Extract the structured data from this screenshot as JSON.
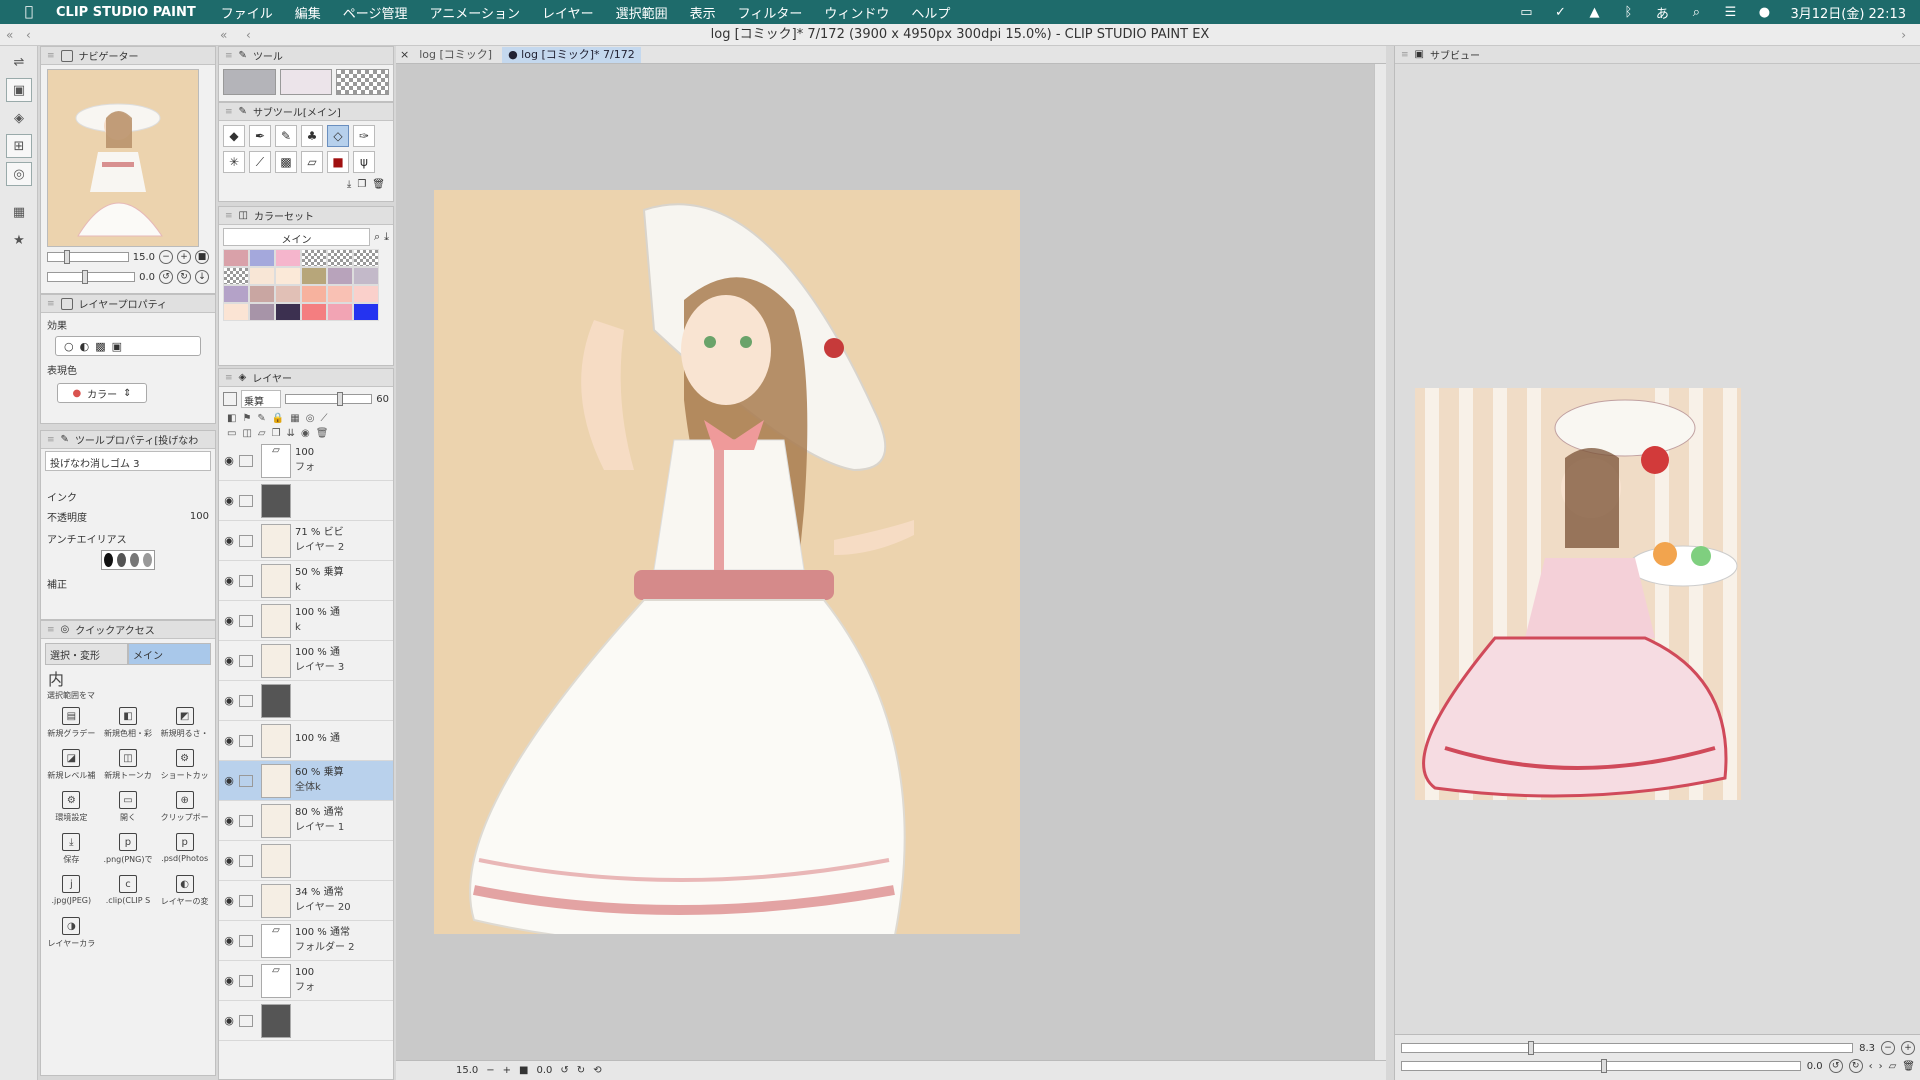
{
  "menubar": {
    "app_name": "CLIP STUDIO PAINT",
    "items": [
      "ファイル",
      "編集",
      "ページ管理",
      "アニメーション",
      "レイヤー",
      "選択範囲",
      "表示",
      "フィルター",
      "ウィンドウ",
      "ヘルプ"
    ],
    "clock": "3月12日(金)  22:13",
    "input_method": "あ"
  },
  "window": {
    "title": "log [コミック]* 7/172 (3900 x 4950px 300dpi 15.0%)  - CLIP STUDIO PAINT EX"
  },
  "navigator": {
    "title": "ナビゲーター",
    "zoom": "15.0",
    "rotation": "0.0"
  },
  "layer_property": {
    "title": "レイヤープロパティ",
    "effect_label": "効果",
    "expression_label": "表現色",
    "expression_value": "カラー"
  },
  "tool_property": {
    "title": "ツールプロパティ[投げなわ",
    "tool_name": "投げなわ消しゴム 3",
    "ink_label": "インク",
    "opacity_label": "不透明度",
    "opacity_value": "100",
    "antialias_label": "アンチエイリアス",
    "correction_label": "補正"
  },
  "quick_access": {
    "title": "クイックアクセス",
    "tabs": [
      "選択・変形",
      "メイン"
    ],
    "first_item": "選択範囲をマ",
    "items": [
      {
        "label": "新規グラデー",
        "icon": "▤"
      },
      {
        "label": "新規色相・彩",
        "icon": "◧"
      },
      {
        "label": "新規明るさ・",
        "icon": "◩"
      },
      {
        "label": "新規レベル補",
        "icon": "◪"
      },
      {
        "label": "新規トーンカ",
        "icon": "◫"
      },
      {
        "label": "ショートカッ",
        "icon": "⚙"
      },
      {
        "label": "環境設定",
        "icon": "⚙"
      },
      {
        "label": "開く",
        "icon": "▭"
      },
      {
        "label": "クリップボー",
        "icon": "⊕"
      },
      {
        "label": "保存",
        "icon": "⤓"
      },
      {
        "label": ".png(PNG)で",
        "icon": "p"
      },
      {
        "label": ".psd(Photos",
        "icon": "p"
      },
      {
        "label": ".jpg(JPEG)",
        "icon": "j"
      },
      {
        "label": ".clip(CLIP S",
        "icon": "c"
      },
      {
        "label": "レイヤーの変",
        "icon": "◐"
      },
      {
        "label": "レイヤーカラ",
        "icon": "◑"
      }
    ]
  },
  "tool_panel": {
    "title": "ツール"
  },
  "subtool": {
    "title": "サブツール[メイン]"
  },
  "colorset": {
    "title": "カラーセット",
    "set_name": "メイン",
    "colors": [
      "#d9a1a9",
      "#a4a8dc",
      "#f5b5cc",
      "checker",
      "checker",
      "checker",
      "checker",
      "#f8e6d6",
      "#fbe9d8",
      "#b7a67a",
      "#b8a3bb",
      "#c3b9c9",
      "#b4a2c8",
      "#c9a6a2",
      "#e1c0b6",
      "#f7b29e",
      "#f9c1b4",
      "#fad0cb",
      "#fbe4d4",
      "#a794a8",
      "#3c3050",
      "#f47e80",
      "#f2a4b4",
      "#2433f0"
    ]
  },
  "layers": {
    "title": "レイヤー",
    "blend_mode": "乗算",
    "opacity": "60",
    "rows": [
      {
        "pct": "100",
        "name": "フォ",
        "folder": true
      },
      {
        "pct": "",
        "name": "",
        "mask": true
      },
      {
        "pct": "71 % ビビ",
        "name": "レイヤー 2"
      },
      {
        "pct": "50 % 乗算",
        "name": "k"
      },
      {
        "pct": "100 % 通",
        "name": "k"
      },
      {
        "pct": "100 % 通",
        "name": "レイヤー 3"
      },
      {
        "pct": "",
        "name": "",
        "mask": true
      },
      {
        "pct": "100 % 通",
        "name": ""
      },
      {
        "pct": "60 % 乗算",
        "name": "全体k",
        "selected": true
      },
      {
        "pct": "80 % 通常",
        "name": "レイヤー 1"
      },
      {
        "pct": "",
        "name": ""
      },
      {
        "pct": "34 % 通常",
        "name": "レイヤー 20"
      },
      {
        "pct": "100 % 通常",
        "name": "フォルダー 2",
        "folder": true
      },
      {
        "pct": "100",
        "name": "フォ",
        "folder": true
      },
      {
        "pct": "",
        "name": "",
        "mask": true
      }
    ]
  },
  "canvas": {
    "tabs": [
      "log [コミック]",
      "● log [コミック]* 7/172"
    ],
    "zoom": "15.0",
    "rotation": "0.0"
  },
  "subview": {
    "title": "サブビュー",
    "zoom": "8.3",
    "rotation": "0.0"
  }
}
